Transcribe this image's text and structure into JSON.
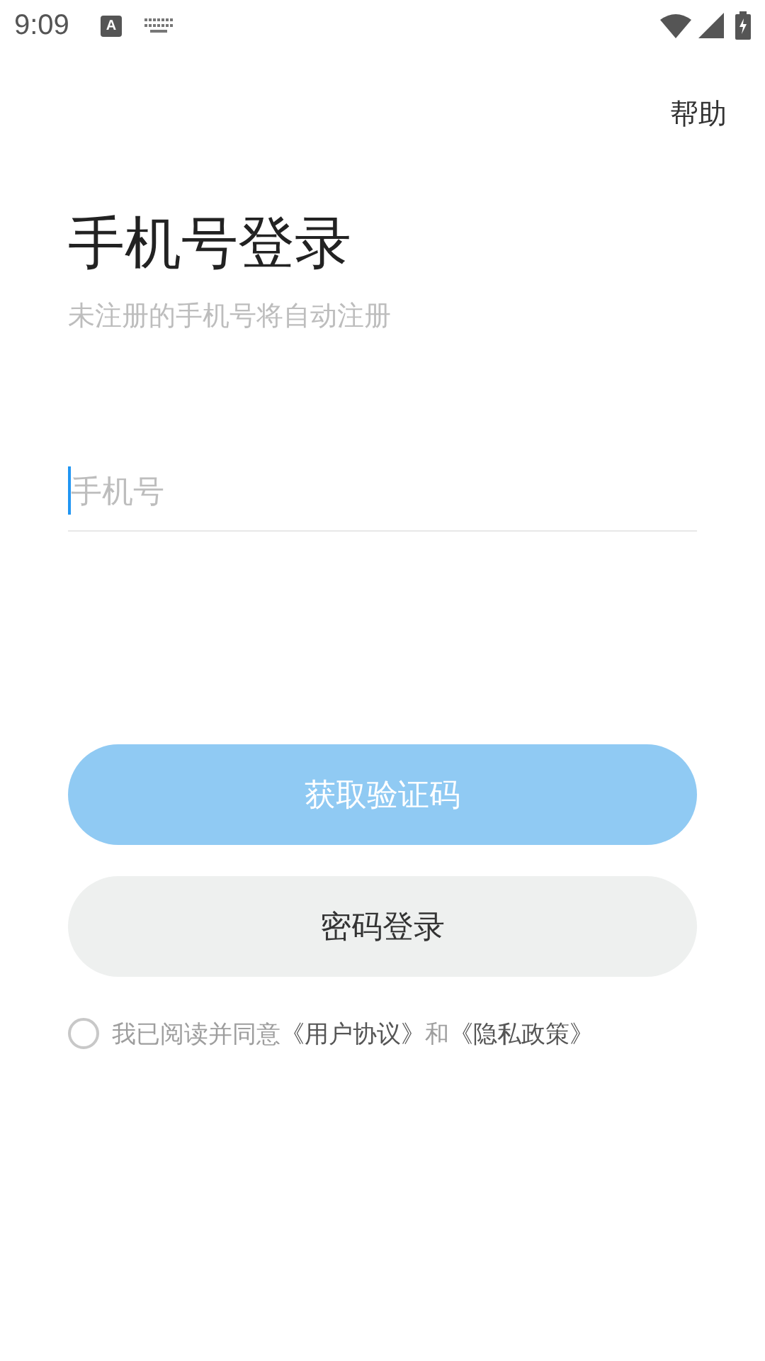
{
  "status_bar": {
    "time": "9:09",
    "input_method": "A"
  },
  "help": "帮助",
  "title": "手机号登录",
  "subtitle": "未注册的手机号将自动注册",
  "phone_field": {
    "placeholder": "手机号",
    "focused": true
  },
  "buttons": [
    {
      "label": "获取验证码",
      "kind": "primary",
      "disabled": true
    },
    {
      "label": "密码登录",
      "kind": "secondary",
      "disabled": false
    }
  ],
  "agreement": {
    "checked": false,
    "text": "我已阅读并同意",
    "links": [
      "《用户协议》",
      "《隐私政策》"
    ],
    "joiner": "和"
  }
}
